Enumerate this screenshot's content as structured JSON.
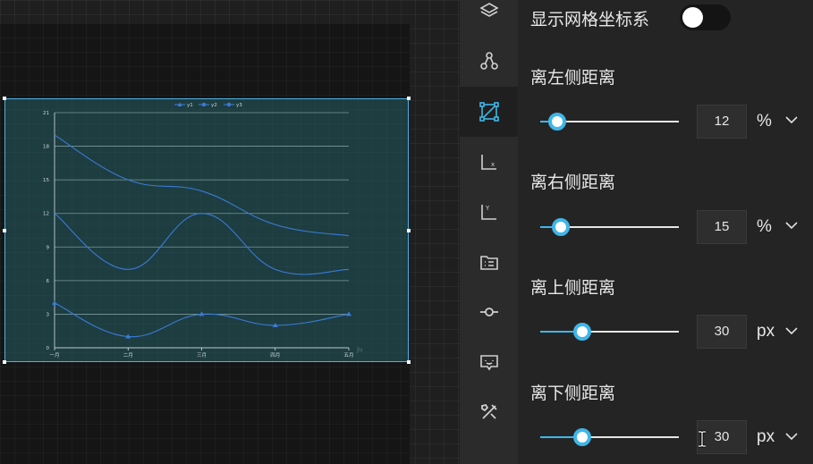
{
  "grid_toggle": {
    "label": "显示网格坐标系",
    "on": false
  },
  "margins": [
    {
      "id": "left",
      "label": "离左侧距离",
      "value": "12",
      "unit": "%",
      "fraction": 0.12
    },
    {
      "id": "right",
      "label": "离右侧距离",
      "value": "15",
      "unit": "%",
      "fraction": 0.15
    },
    {
      "id": "top",
      "label": "离上侧距离",
      "value": "30",
      "unit": "px",
      "fraction": 0.3
    },
    {
      "id": "bottom",
      "label": "离下侧距离",
      "value": "30",
      "unit": "px",
      "fraction": 0.3
    }
  ],
  "rail_icons": [
    "layers-icon",
    "relation-icon",
    "grid-frame-icon",
    "x-axis-icon",
    "y-axis-icon",
    "legend-icon",
    "marker-icon",
    "tooltip-icon",
    "tools-icon"
  ],
  "rail_active_index": 2,
  "colors": {
    "accent": "#3fb6e8",
    "series": "#3a7bd5",
    "selection": "#4fb3e6"
  },
  "chart_data": {
    "type": "line",
    "title": "",
    "categories": [
      "一月",
      "二月",
      "三月",
      "四月",
      "五月"
    ],
    "series": [
      {
        "name": "y1",
        "values": [
          4,
          1,
          3,
          2,
          3
        ]
      },
      {
        "name": "y2",
        "values": [
          12,
          7,
          12,
          7,
          7
        ]
      },
      {
        "name": "y3",
        "values": [
          19,
          15,
          14,
          11,
          10
        ]
      }
    ],
    "y_ticks": [
      "0",
      "3",
      "6",
      "9",
      "12",
      "15",
      "18",
      "21"
    ],
    "ylim": [
      0,
      21
    ],
    "legend": "top-center",
    "grid": true,
    "corner_text": "Ju"
  }
}
